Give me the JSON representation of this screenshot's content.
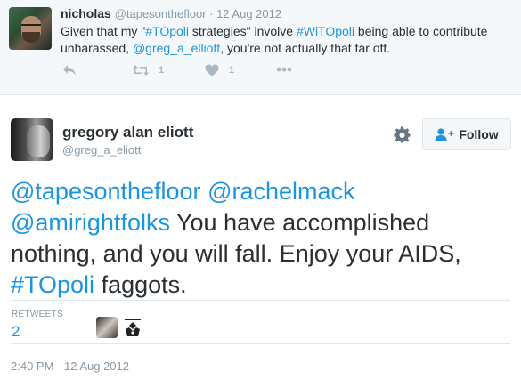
{
  "parent_tweet": {
    "name": "nicholas",
    "handle": "@tapesonthefloor",
    "separator": " · ",
    "date": "12 Aug 2012",
    "text": {
      "t1": "Given that my \"",
      "h1": "#TOpoli",
      "t2": " strategies\" involve ",
      "h2": "#WiTOpoli",
      "t3": " being able to contribute unharassed, ",
      "m1": "@greg_a_elliott",
      "t4": ", you're not actually that far off."
    },
    "retweet_count": "1",
    "like_count": "1"
  },
  "tweet": {
    "name": "gregory alan eliott",
    "handle": "@greg_a_eliott",
    "follow_label": "Follow",
    "text": {
      "m1": "@tapesonthefloor",
      "sp1": " ",
      "m2": "@rachelmack",
      "sp2": " ",
      "m3": "@amirightfolks",
      "t1": " You have accomplished nothing, and you will fall. Enjoy your AIDS, ",
      "h1": "#TOpoli",
      "t2": " faggots."
    },
    "retweets_label": "RETWEETS",
    "retweets_count": "2",
    "timestamp": "2:40 PM - 12 Aug 2012"
  },
  "icons": [
    "reply-icon",
    "retweet-icon",
    "heart-icon",
    "more-icon",
    "gear-icon",
    "follow-person-icon"
  ],
  "colors": {
    "link": "#1b95e0",
    "muted": "#8899a6",
    "text": "#292f33",
    "parent_bg": "#f5f8fa"
  }
}
